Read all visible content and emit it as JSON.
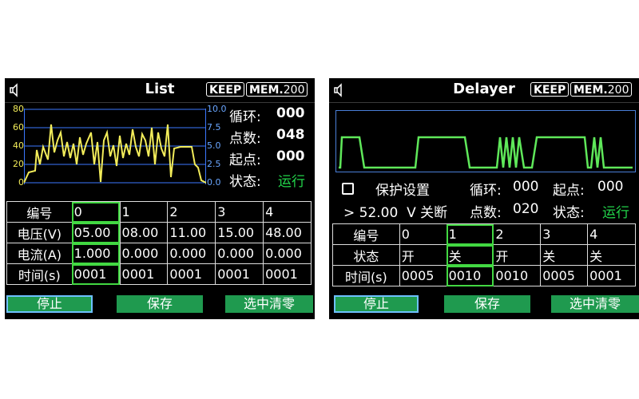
{
  "left": {
    "title": "List",
    "keep": "KEEP",
    "mem_prefix": "MEM.",
    "mem_num": "200",
    "y_left_ticks": [
      "80",
      "60",
      "40",
      "20",
      "0"
    ],
    "y_right_ticks": [
      "10.0",
      "7.5",
      "5.0",
      "2.5",
      "0.0"
    ],
    "stats": [
      {
        "label": "循环:",
        "value": "000"
      },
      {
        "label": "点数:",
        "value": "048"
      },
      {
        "label": "起点:",
        "value": "000"
      },
      {
        "label": "状态:",
        "value": "运行"
      }
    ],
    "table": {
      "header": [
        "编号",
        "0",
        "1",
        "2",
        "3",
        "4"
      ],
      "rows": [
        [
          "电压(V)",
          "05.00",
          "08.00",
          "11.00",
          "15.00",
          "48.00"
        ],
        [
          "电流(A)",
          "1.000",
          "0.000",
          "0.000",
          "0.000",
          "0.000"
        ],
        [
          "时间(s)",
          "0001",
          "0001",
          "0001",
          "0001",
          "0001"
        ]
      ]
    },
    "buttons": [
      "停止",
      "保存",
      "选中清零"
    ],
    "colors": {
      "waveform": "#f2ec5a",
      "grid": "#3b78ff",
      "status": "#22d44a",
      "button": "#1f9a4f"
    }
  },
  "right": {
    "title": "Delayer",
    "keep": "KEEP",
    "mem_prefix": "MEM.",
    "mem_num": "200",
    "protect_label": "保护设置",
    "cycle_label": "循环:",
    "cycle_value": "000",
    "start_label": "起点:",
    "start_value": "000",
    "threshold": "> 52.00  V 关断",
    "points_label": "点数:",
    "points_value": "020",
    "status_label": "状态:",
    "status_value": "运行",
    "table": {
      "header": [
        "编号",
        "0",
        "1",
        "2",
        "3",
        "4"
      ],
      "rows": [
        [
          "状态",
          "开",
          "关",
          "开",
          "关",
          "关"
        ],
        [
          "时间(s)",
          "0005",
          "0010",
          "0010",
          "0005",
          "0001"
        ]
      ]
    },
    "buttons": [
      "停止",
      "保存",
      "选中清零"
    ],
    "colors": {
      "waveform": "#5fe85a",
      "frame": "#4a7fd8"
    }
  }
}
